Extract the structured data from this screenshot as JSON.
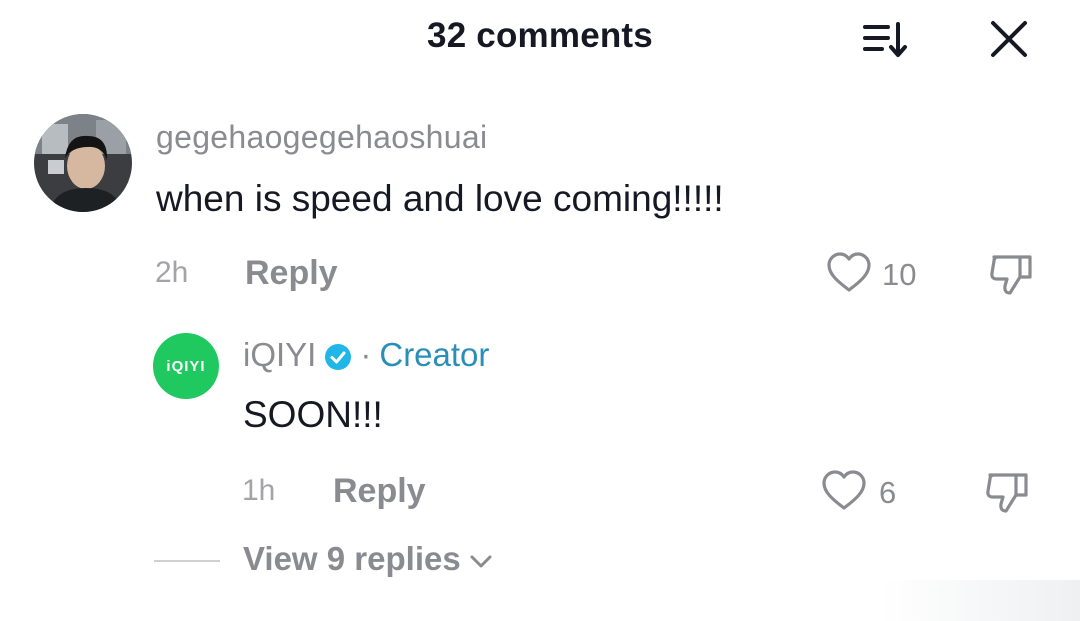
{
  "header": {
    "title": "32 comments",
    "sort_icon": "sort-descending-icon",
    "close_icon": "close-icon"
  },
  "comments": [
    {
      "username": "gegehaogegehaoshuai",
      "text": "when is speed and love coming!!!!!",
      "time": "2h",
      "reply_label": "Reply",
      "likes": "10",
      "avatar": "user-photo-avatar"
    }
  ],
  "reply": {
    "username": "iQIYI",
    "avatar_text": "iQIYI",
    "verified_icon": "verified-check-icon",
    "separator": "·",
    "role": "Creator",
    "text": "SOON!!!",
    "time": "1h",
    "reply_label": "Reply",
    "likes": "6"
  },
  "view_replies": {
    "label": "View 9 replies",
    "icon": "chevron-down-icon"
  },
  "colors": {
    "text_primary": "#161823",
    "text_secondary": "#8a8b91",
    "creator_accent": "#2a8fb7",
    "verified_badge": "#20b6e8",
    "brand_green": "#1fc95f"
  }
}
